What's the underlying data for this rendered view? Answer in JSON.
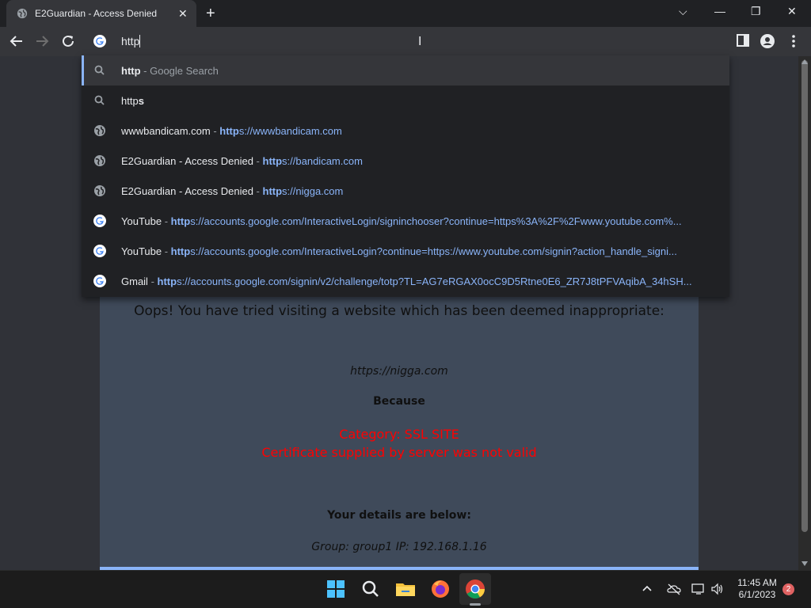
{
  "tab": {
    "title": "E2Guardian - Access Denied",
    "close": "✕"
  },
  "new_tab": "+",
  "window_controls": {
    "dropdown": "⌵",
    "minimize": "—",
    "restore": "❐",
    "close": "✕"
  },
  "omnibox": {
    "typed": "http"
  },
  "suggestions": [
    {
      "icon": "search-icon",
      "bold": "http",
      "rest": "",
      "sep": " - ",
      "hint": "Google Search",
      "url_bold": "",
      "url_rest": ""
    },
    {
      "icon": "search-icon",
      "bold": "http",
      "rest": "s",
      "sep": "",
      "hint": "",
      "url_bold": "",
      "url_rest": ""
    },
    {
      "icon": "globe-icon",
      "bold": "",
      "rest": "wwwbandicam.com",
      "sep": " - ",
      "hint": "",
      "url_bold": "http",
      "url_rest": "s://wwwbandicam.com"
    },
    {
      "icon": "globe-icon",
      "bold": "",
      "rest": "E2Guardian - Access Denied",
      "sep": " - ",
      "hint": "",
      "url_bold": "http",
      "url_rest": "s://bandicam.com"
    },
    {
      "icon": "globe-icon",
      "bold": "",
      "rest": "E2Guardian - Access Denied",
      "sep": " - ",
      "hint": "",
      "url_bold": "http",
      "url_rest": "s://nigga.com"
    },
    {
      "icon": "google-icon",
      "bold": "",
      "rest": "YouTube",
      "sep": " - ",
      "hint": "",
      "url_bold": "http",
      "url_rest": "s://accounts.google.com/InteractiveLogin/signinchooser?continue=https%3A%2F%2Fwww.youtube.com%..."
    },
    {
      "icon": "google-icon",
      "bold": "",
      "rest": "YouTube",
      "sep": " - ",
      "hint": "",
      "url_bold": "http",
      "url_rest": "s://accounts.google.com/InteractiveLogin?continue=https://www.youtube.com/signin?action_handle_signi..."
    },
    {
      "icon": "google-icon",
      "bold": "",
      "rest": "Gmail",
      "sep": " - ",
      "hint": "",
      "url_bold": "http",
      "url_rest": "s://accounts.google.com/signin/v2/challenge/totp?TL=AG7eRGAX0ocC9D5Rtne0E6_ZR7J8tPFVAqibA_34hSH..."
    }
  ],
  "page": {
    "heading": "Oops! You have tried visiting a website which has been deemed inappropriate:",
    "url": "https://nigga.com",
    "because": "Because",
    "category": "Category: SSL SITE",
    "reason": "Certificate supplied by server was not valid",
    "details_label": "Your details are below:",
    "details": "Group: group1   IP: 192.168.1.16"
  },
  "taskbar": {
    "time": "11:45 AM",
    "date": "6/1/2023",
    "notifications": "2"
  },
  "colors": {
    "accent": "#8ab4f8",
    "error": "#ff0000",
    "card": "#3f4a5a"
  }
}
